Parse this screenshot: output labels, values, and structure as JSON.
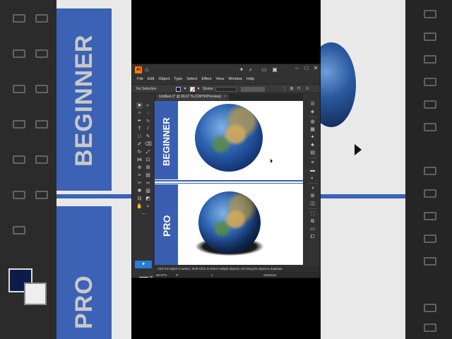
{
  "app": {
    "menu": [
      "File",
      "Edit",
      "Object",
      "Type",
      "Select",
      "Effect",
      "View",
      "Window",
      "Help"
    ],
    "control_bar": {
      "selection_label": "No Selection",
      "stroke_label": "Stroke:"
    },
    "document_tab": {
      "title": "Untitled-1* @ 66.67 % (CMYK/Preview)",
      "close": "×"
    },
    "status": {
      "hint": "Click the object to select  |  Shift+Click to select multiple objects  |  Alt+Drag the object to duplicate",
      "zoom": "66.67%",
      "rotation": "0°",
      "page": "1",
      "mode": "Selection"
    },
    "colors": {
      "fill": "#0d1b4a",
      "accent_blue": "#3a5fb2",
      "stroke_none_red": "#e02020"
    }
  },
  "artwork": {
    "top_label": "BEGINNER",
    "bottom_label": "PRO"
  },
  "background": {
    "left_word_top": "BEGINNER",
    "left_word_bottom": "PRO"
  }
}
